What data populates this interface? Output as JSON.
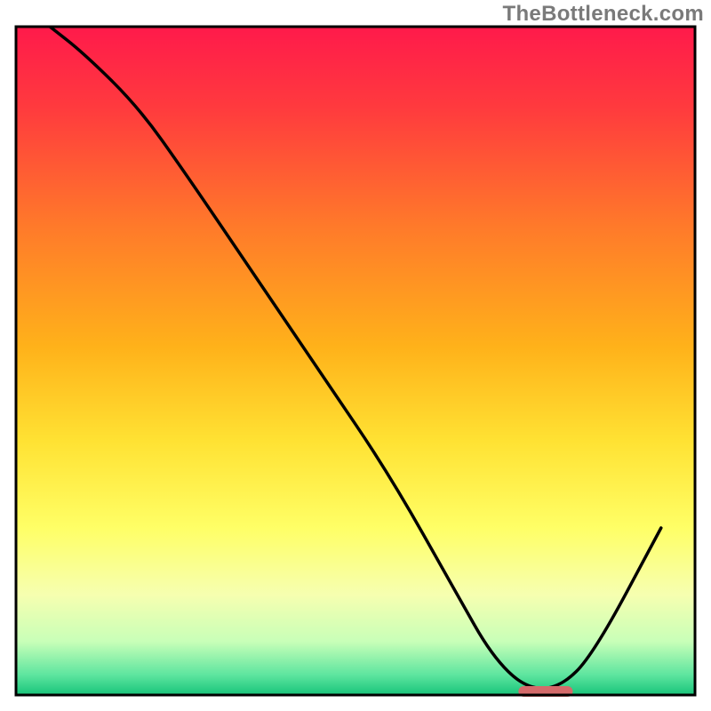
{
  "watermark": "TheBottleneck.com",
  "chart_data": {
    "type": "line",
    "title": "",
    "xlabel": "",
    "ylabel": "",
    "xlim": [
      0,
      100
    ],
    "ylim": [
      0,
      100
    ],
    "series": [
      {
        "name": "bottleneck-curve",
        "x": [
          5,
          10,
          18,
          25,
          35,
          45,
          55,
          65,
          70,
          75,
          80,
          85,
          95
        ],
        "values": [
          100,
          96,
          88,
          78,
          63,
          48,
          33,
          15,
          6,
          1,
          1,
          6,
          25
        ]
      }
    ],
    "marker": {
      "name": "optimal-range",
      "x_start": 74,
      "x_end": 82,
      "y": 0
    },
    "gradient_stops": [
      {
        "offset": 0.0,
        "color": "#ff1a4b"
      },
      {
        "offset": 0.12,
        "color": "#ff3a3e"
      },
      {
        "offset": 0.3,
        "color": "#ff7a2a"
      },
      {
        "offset": 0.48,
        "color": "#ffb21a"
      },
      {
        "offset": 0.62,
        "color": "#ffe233"
      },
      {
        "offset": 0.75,
        "color": "#ffff66"
      },
      {
        "offset": 0.85,
        "color": "#f6ffb0"
      },
      {
        "offset": 0.92,
        "color": "#c8ffb8"
      },
      {
        "offset": 0.97,
        "color": "#5de59f"
      },
      {
        "offset": 1.0,
        "color": "#18c47a"
      }
    ],
    "marker_color": "#d46a6a",
    "curve_color": "#000000",
    "frame_color": "#000000"
  }
}
